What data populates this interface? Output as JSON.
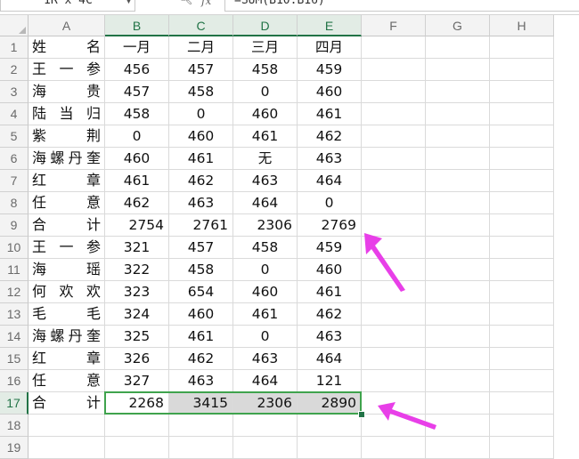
{
  "formula_bar": {
    "name_box_value": "1R x 4C",
    "fx_label": "fx",
    "formula_value": "=SUM(B10:B16)"
  },
  "columns": [
    "A",
    "B",
    "C",
    "D",
    "E",
    "F",
    "G",
    "H"
  ],
  "rows": [
    {
      "num": "1",
      "cells": [
        "姓　　名",
        "一月",
        "二月",
        "三月",
        "四月"
      ]
    },
    {
      "num": "2",
      "cells": [
        "王 一 参",
        "456",
        "457",
        "458",
        "459"
      ]
    },
    {
      "num": "3",
      "cells": [
        "海　　贵",
        "457",
        "458",
        "0",
        "460"
      ]
    },
    {
      "num": "4",
      "cells": [
        "陆 当 归",
        "458",
        "0",
        "460",
        "461"
      ]
    },
    {
      "num": "5",
      "cells": [
        "紫　　荆",
        "0",
        "460",
        "461",
        "462"
      ]
    },
    {
      "num": "6",
      "cells": [
        "海螺丹奎",
        "460",
        "461",
        "无",
        "463"
      ]
    },
    {
      "num": "7",
      "cells": [
        "红　　章",
        "461",
        "462",
        "463",
        "464"
      ]
    },
    {
      "num": "8",
      "cells": [
        "任　　意",
        "462",
        "463",
        "464",
        "0"
      ]
    },
    {
      "num": "9",
      "cells": [
        "合　　计",
        "2754",
        "2761",
        "2306",
        "2769"
      ]
    },
    {
      "num": "10",
      "cells": [
        "王 一 参",
        "321",
        "457",
        "458",
        "459"
      ]
    },
    {
      "num": "11",
      "cells": [
        "海　　瑶",
        "322",
        "458",
        "0",
        "460"
      ]
    },
    {
      "num": "12",
      "cells": [
        "何 欢 欢",
        "323",
        "654",
        "460",
        "461"
      ]
    },
    {
      "num": "13",
      "cells": [
        "毛　　毛",
        "324",
        "460",
        "461",
        "462"
      ]
    },
    {
      "num": "14",
      "cells": [
        "海螺丹奎",
        "325",
        "461",
        "0",
        "463"
      ]
    },
    {
      "num": "15",
      "cells": [
        "红　　章",
        "326",
        "462",
        "463",
        "464"
      ]
    },
    {
      "num": "16",
      "cells": [
        "任　　意",
        "327",
        "463",
        "464",
        "121"
      ]
    },
    {
      "num": "17",
      "cells": [
        "合　　计",
        "2268",
        "3415",
        "2306",
        "2890"
      ]
    },
    {
      "num": "18",
      "cells": [
        "",
        "",
        "",
        "",
        ""
      ]
    },
    {
      "num": "19",
      "cells": [
        "",
        "",
        "",
        "",
        ""
      ]
    }
  ],
  "colors": {
    "selection_border": "#3fa34d",
    "header_selected": "#217346",
    "annotation_arrow": "#e83fe8",
    "selected_fill": "#d9d9d9"
  },
  "icons": {
    "zoom": "magnifier-icon",
    "dropdown": "chevron-down-icon"
  }
}
